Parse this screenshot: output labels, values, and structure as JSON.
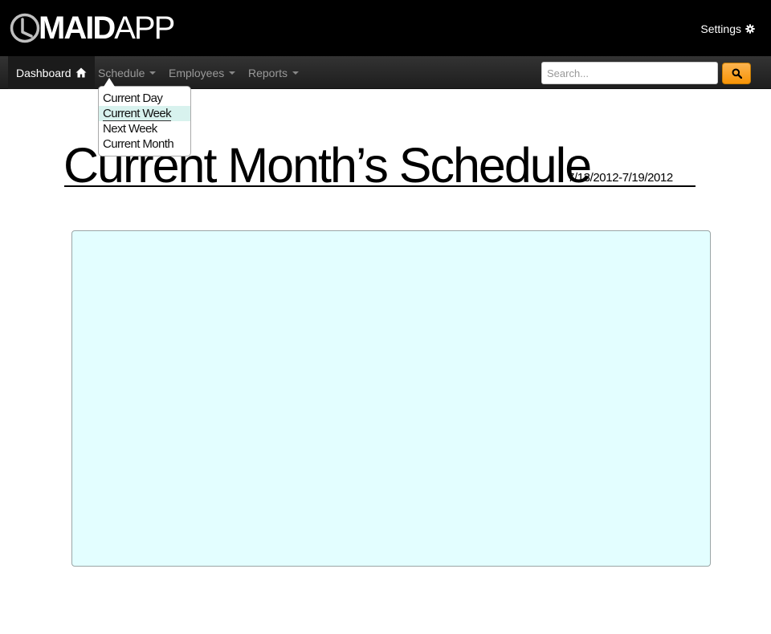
{
  "header": {
    "logo_bold": "MAID",
    "logo_thin": "APP",
    "settings_label": "Settings"
  },
  "navbar": {
    "items": [
      {
        "label": "Dashboard",
        "icon": "home-icon",
        "active": true
      },
      {
        "label": "Schedule",
        "dropdown": true
      },
      {
        "label": "Employees",
        "dropdown": true
      },
      {
        "label": "Reports",
        "dropdown": true
      }
    ],
    "search_placeholder": "Search...",
    "search_icon": "search-icon"
  },
  "schedule_menu": {
    "items": [
      {
        "label": "Current Day"
      },
      {
        "label": "Current Week",
        "highlighted": true
      },
      {
        "label": "Next Week"
      },
      {
        "label": "Current Month"
      }
    ]
  },
  "main": {
    "title": "Current Month’s Schedule",
    "date_range": "7/13/2012-7/19/2012"
  },
  "colors": {
    "header_bg": "#000000",
    "navbar_bg": "#2c2c2c",
    "search_button": "#f89406",
    "panel_bg": "#e3feff",
    "menu_highlight": "#d8f2ee"
  }
}
